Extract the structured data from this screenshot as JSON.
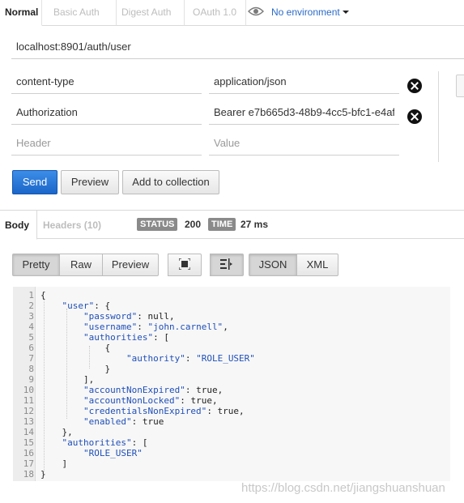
{
  "auth_tabs": [
    {
      "label": "Normal",
      "active": true
    },
    {
      "label": "Basic Auth",
      "active": false
    },
    {
      "label": "Digest Auth",
      "active": false
    },
    {
      "label": "OAuth 1.0",
      "active": false
    }
  ],
  "environment": {
    "label": "No environment",
    "icon": "eye-icon"
  },
  "request": {
    "url": "localhost:8901/auth/user"
  },
  "headers": [
    {
      "key": "content-type",
      "value": "application/json"
    },
    {
      "key": "Authorization",
      "value": "Bearer e7b665d3-48b9-4cc5-bfc1-e4af"
    }
  ],
  "new_header": {
    "key_placeholder": "Header",
    "value_placeholder": "Value"
  },
  "actions": {
    "send": "Send",
    "preview": "Preview",
    "add_to_collection": "Add to collection"
  },
  "response_tabs": {
    "body": "Body",
    "headers": "Headers (10)"
  },
  "status": {
    "status_label": "STATUS",
    "status_value": "200",
    "time_label": "TIME",
    "time_value": "27 ms"
  },
  "format_toolbar": {
    "pretty": "Pretty",
    "raw": "Raw",
    "preview": "Preview",
    "json": "JSON",
    "xml": "XML"
  },
  "code_lines": [
    {
      "n": "1",
      "t": "{"
    },
    {
      "n": "2",
      "t": "    \"user\": {"
    },
    {
      "n": "3",
      "t": "        \"password\": null,"
    },
    {
      "n": "4",
      "t": "        \"username\": \"john.carnell\","
    },
    {
      "n": "5",
      "t": "        \"authorities\": ["
    },
    {
      "n": "6",
      "t": "            {"
    },
    {
      "n": "7",
      "t": "                \"authority\": \"ROLE_USER\""
    },
    {
      "n": "8",
      "t": "            }"
    },
    {
      "n": "9",
      "t": "        ],"
    },
    {
      "n": "10",
      "t": "        \"accountNonExpired\": true,"
    },
    {
      "n": "11",
      "t": "        \"accountNonLocked\": true,"
    },
    {
      "n": "12",
      "t": "        \"credentialsNonExpired\": true,"
    },
    {
      "n": "13",
      "t": "        \"enabled\": true"
    },
    {
      "n": "14",
      "t": "    },"
    },
    {
      "n": "15",
      "t": "    \"authorities\": ["
    },
    {
      "n": "16",
      "t": "        \"ROLE_USER\""
    },
    {
      "n": "17",
      "t": "    ]"
    },
    {
      "n": "18",
      "t": "}"
    }
  ],
  "watermark": "https://blog.csdn.net/jiangshuanshuan",
  "colors": {
    "send_button": "#1a66c9",
    "badge": "#8a8a8a",
    "json_key": "#1f4fb8",
    "env_link": "#2a6ac8"
  }
}
